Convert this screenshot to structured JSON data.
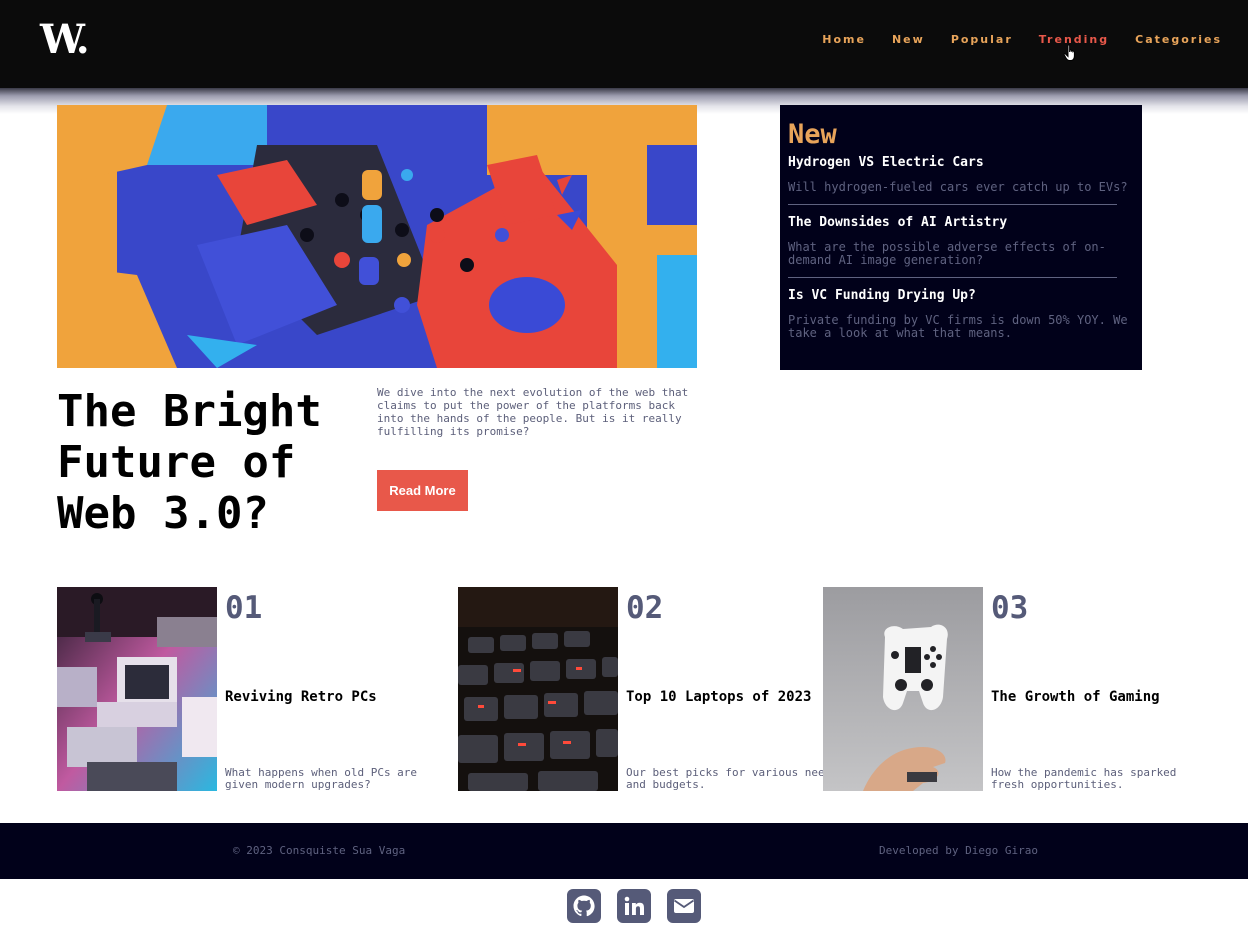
{
  "header": {
    "logo": "W.",
    "nav": [
      "Home",
      "New",
      "Popular",
      "Trending",
      "Categories"
    ],
    "active_nav": "Trending"
  },
  "hero": {
    "title": "The Bright Future of Web 3.0?",
    "description": "We dive into the next evolution of the web that claims to put the power of the platforms back into the hands of the people. But is it really fulfilling its promise?",
    "button": "Read More"
  },
  "new_panel": {
    "heading": "New",
    "items": [
      {
        "title": "Hydrogen VS Electric Cars",
        "description": "Will hydrogen-fueled cars ever catch up to EVs?"
      },
      {
        "title": "The Downsides of AI Artistry",
        "description": "What are the possible adverse effects of on-demand AI image generation?"
      },
      {
        "title": "Is VC Funding Drying Up?",
        "description": "Private funding by VC firms is down 50% YOY. We take a look at what that means."
      }
    ]
  },
  "cards": [
    {
      "number": "01",
      "title": "Reviving Retro PCs",
      "description": "What happens when old PCs are given modern upgrades?"
    },
    {
      "number": "02",
      "title": "Top 10 Laptops of 2023",
      "description": "Our best picks for various needs and budgets."
    },
    {
      "number": "03",
      "title": "The Growth of Gaming",
      "description": "How the pandemic has sparked fresh opportunities."
    }
  ],
  "footer": {
    "copyright": "© 2023 Consquiste Sua Vaga",
    "developer": "Developed by Diego Girao"
  },
  "socials": [
    "github-icon",
    "linkedin-icon",
    "envelope-icon"
  ],
  "colors": {
    "accent_orange": "#e8a45a",
    "accent_red": "#e8584a",
    "dark_navy": "#01011a",
    "muted_text": "#5f6280"
  }
}
